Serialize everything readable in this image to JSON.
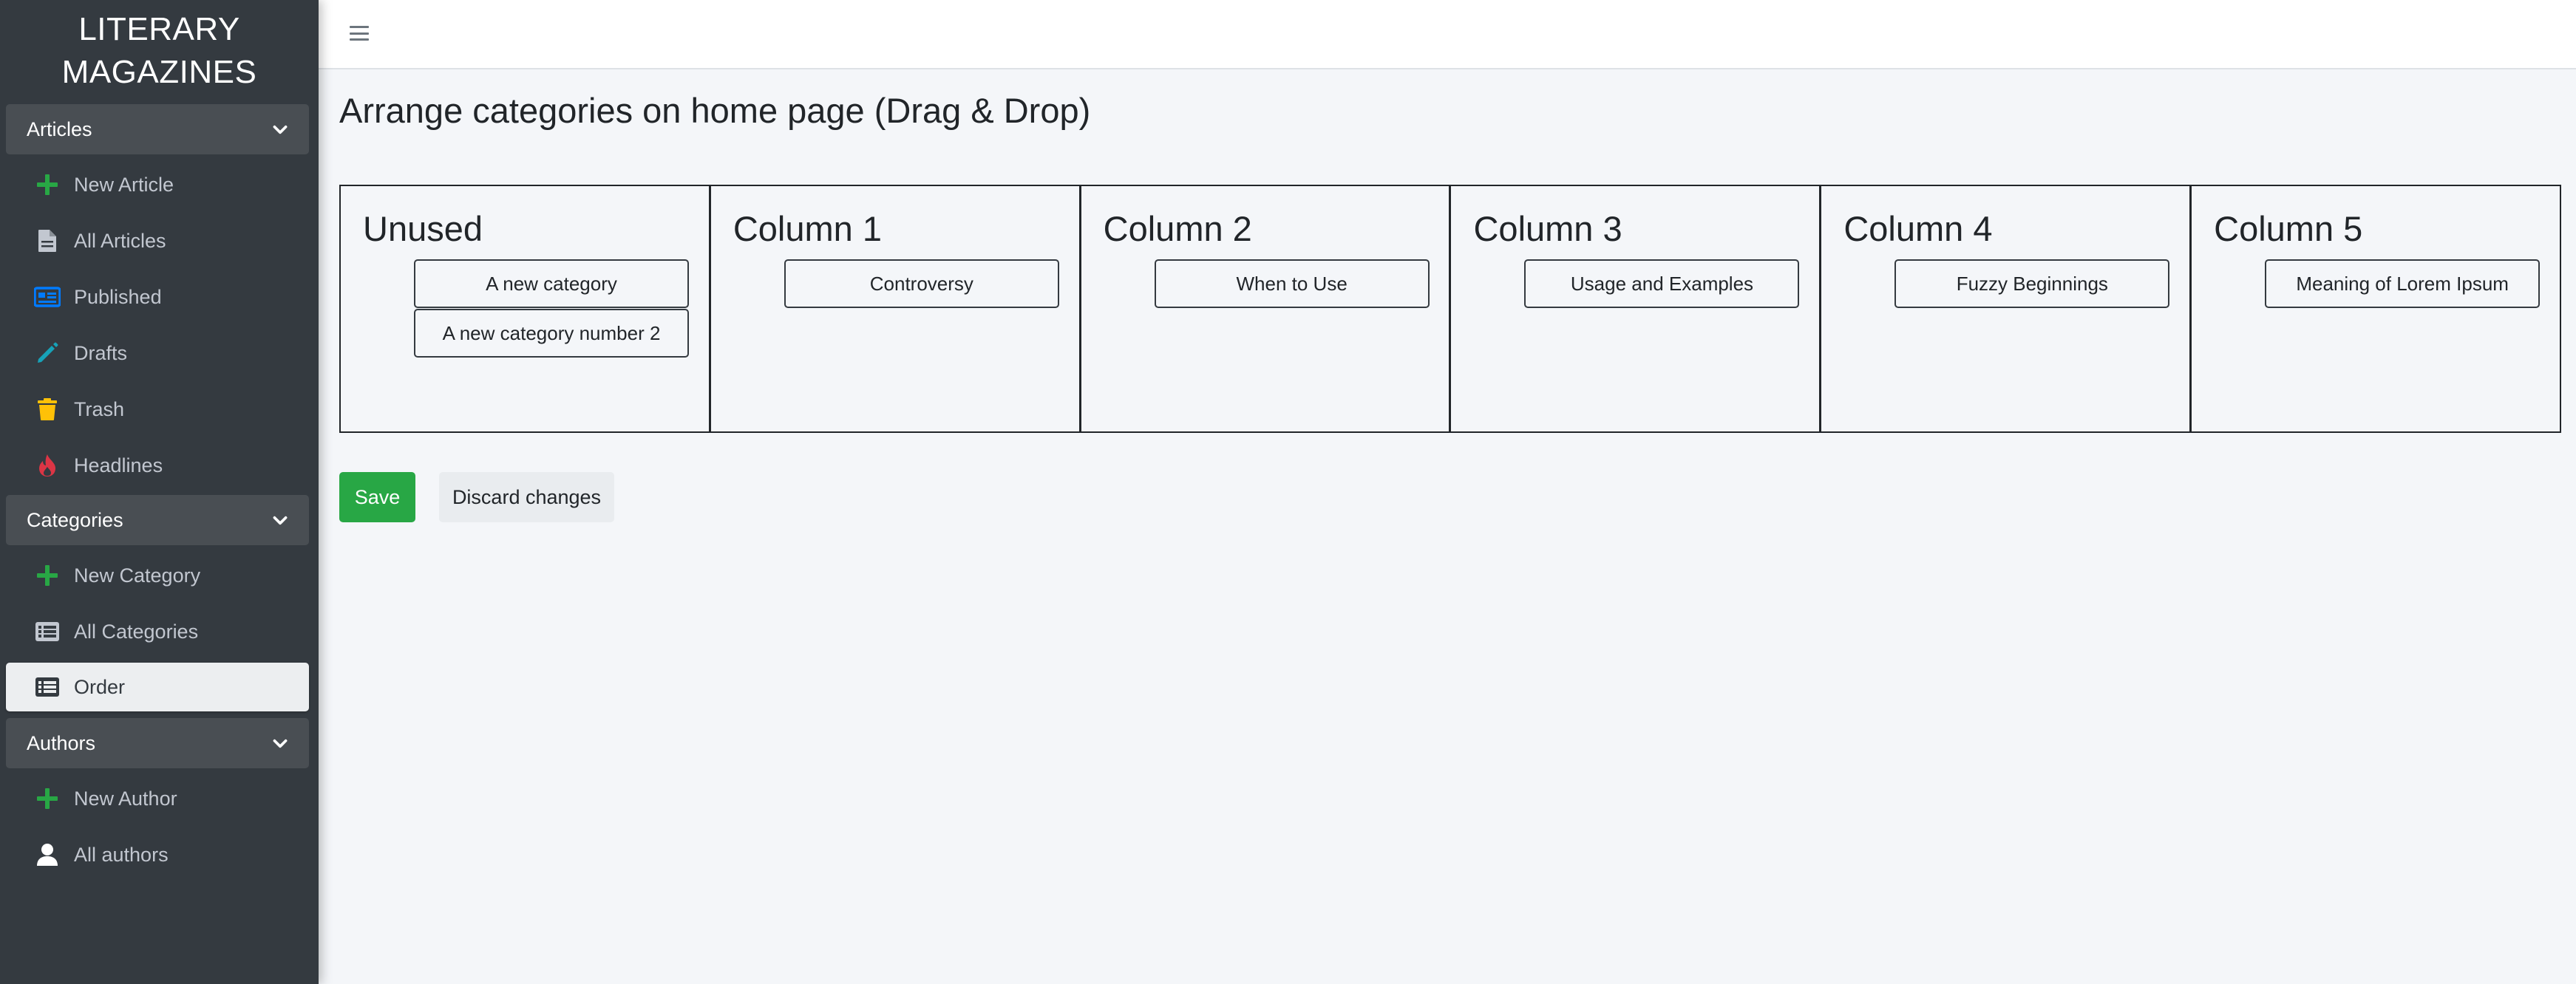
{
  "brand": {
    "line1": "LITERARY",
    "line2": "MAGAZINES"
  },
  "sidebar": {
    "groups": [
      {
        "label": "Articles",
        "items": [
          {
            "label": "New Article",
            "icon": "plus-icon"
          },
          {
            "label": "All Articles",
            "icon": "file-icon"
          },
          {
            "label": "Published",
            "icon": "newspaper-icon"
          },
          {
            "label": "Drafts",
            "icon": "pencil-icon"
          },
          {
            "label": "Trash",
            "icon": "trash-icon"
          },
          {
            "label": "Headlines",
            "icon": "fire-icon"
          }
        ]
      },
      {
        "label": "Categories",
        "items": [
          {
            "label": "New Category",
            "icon": "plus-icon"
          },
          {
            "label": "All Categories",
            "icon": "list-icon"
          },
          {
            "label": "Order",
            "icon": "list-icon",
            "active": true
          }
        ]
      },
      {
        "label": "Authors",
        "items": [
          {
            "label": "New Author",
            "icon": "plus-icon"
          },
          {
            "label": "All authors",
            "icon": "user-icon"
          }
        ]
      }
    ]
  },
  "main": {
    "title": "Arrange categories on home page (Drag & Drop)",
    "columns": [
      {
        "title": "Unused",
        "categories": [
          "A new category",
          "A new category number 2"
        ]
      },
      {
        "title": "Column 1",
        "categories": [
          "Controversy"
        ]
      },
      {
        "title": "Column 2",
        "categories": [
          "When to Use"
        ]
      },
      {
        "title": "Column 3",
        "categories": [
          "Usage and Examples"
        ]
      },
      {
        "title": "Column 4",
        "categories": [
          "Fuzzy Beginnings"
        ]
      },
      {
        "title": "Column 5",
        "categories": [
          "Meaning of Lorem Ipsum"
        ]
      }
    ],
    "save_label": "Save",
    "discard_label": "Discard changes"
  },
  "colors": {
    "sidebar_bg": "#343a40",
    "plus_icon": "#28a745",
    "file_icon": "#c2c7d0",
    "newspaper_icon": "#007bff",
    "pencil_icon": "#17a2b8",
    "trash_icon": "#ffc107",
    "fire_icon": "#dc3545",
    "save_button": "#28a745"
  }
}
